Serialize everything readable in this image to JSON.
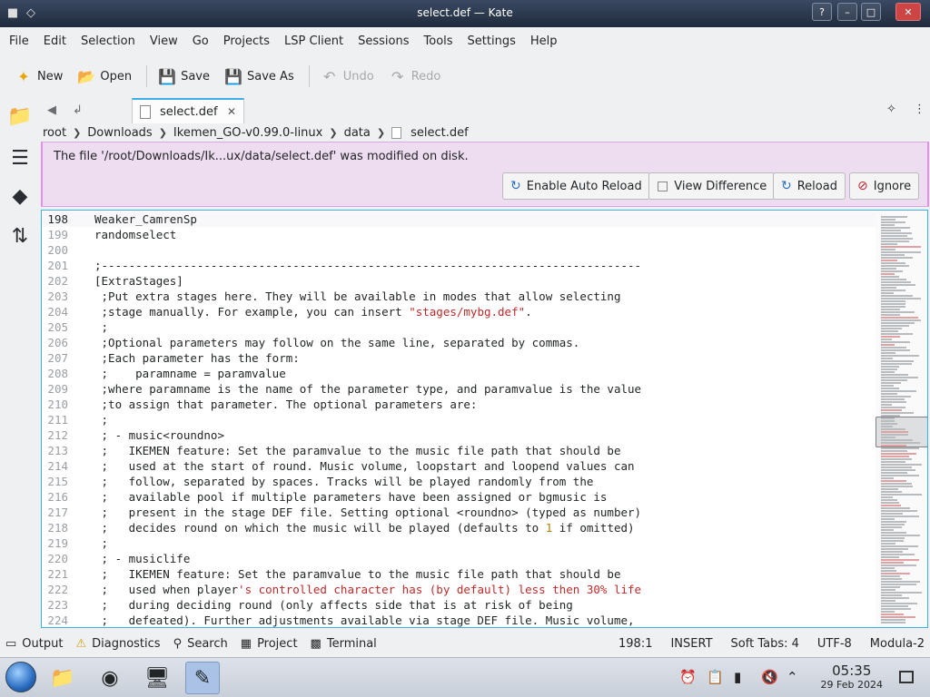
{
  "window": {
    "title": "select.def — Kate",
    "help_label": "?",
    "minimize_label": "–",
    "maximize_label": "□",
    "close_label": "✕"
  },
  "menu": [
    "File",
    "Edit",
    "Selection",
    "View",
    "Go",
    "Projects",
    "LSP Client",
    "Sessions",
    "Tools",
    "Settings",
    "Help"
  ],
  "toolbar": {
    "new": "New",
    "open": "Open",
    "save": "Save",
    "save_as": "Save As",
    "undo": "Undo",
    "redo": "Redo"
  },
  "tabs": {
    "active": "select.def",
    "close_label": "✕"
  },
  "breadcrumb": [
    "root",
    "Downloads",
    "Ikemen_GO-v0.99.0-linux",
    "data",
    "select.def"
  ],
  "banner": {
    "message": "The file '/root/Downloads/Ik...ux/data/select.def' was modified on disk.",
    "enable_auto_reload": "Enable Auto Reload",
    "view_difference": "View Difference",
    "reload": "Reload",
    "ignore": "Ignore"
  },
  "editor": {
    "lines": [
      {
        "n": "198",
        "text": "Weaker_CamrenSp",
        "current": true
      },
      {
        "n": "199",
        "text": "randomselect"
      },
      {
        "n": "200",
        "text": ""
      },
      {
        "n": "201",
        "text": ";-------------------------------------------------------------------------------"
      },
      {
        "n": "202",
        "text": "[ExtraStages]"
      },
      {
        "n": "203",
        "text": " ;Put extra stages here. They will be available in modes that allow selecting"
      },
      {
        "n": "204",
        "text": " ;stage manually. For example, you can insert ",
        "str": "\"stages/mybg.def\"",
        "after": "."
      },
      {
        "n": "205",
        "text": " ;"
      },
      {
        "n": "206",
        "text": " ;Optional parameters may follow on the same line, separated by commas."
      },
      {
        "n": "207",
        "text": " ;Each parameter has the form:"
      },
      {
        "n": "208",
        "text": " ;    paramname = paramvalue"
      },
      {
        "n": "209",
        "text": " ;where paramname is the name of the parameter type, and paramvalue is the value"
      },
      {
        "n": "210",
        "text": " ;to assign that parameter. The optional parameters are:"
      },
      {
        "n": "211",
        "text": " ;"
      },
      {
        "n": "212",
        "text": " ; - music<roundno>"
      },
      {
        "n": "213",
        "text": " ;   IKEMEN feature: Set the paramvalue to the music file path that should be"
      },
      {
        "n": "214",
        "text": " ;   used at the start of round. Music volume, loopstart and loopend values can"
      },
      {
        "n": "215",
        "text": " ;   follow, separated by spaces. Tracks will be played randomly from the"
      },
      {
        "n": "216",
        "text": " ;   available pool if multiple parameters have been assigned or bgmusic is"
      },
      {
        "n": "217",
        "text": " ;   present in the stage DEF file. Setting optional <roundno> (typed as number)"
      },
      {
        "n": "218",
        "text": " ;   decides round on which the music will be played (defaults to ",
        "num": "1",
        "after": " if omitted)"
      },
      {
        "n": "219",
        "text": " ;"
      },
      {
        "n": "220",
        "text": " ; - musiclife"
      },
      {
        "n": "221",
        "text": " ;   IKEMEN feature: Set the paramvalue to the music file path that should be"
      },
      {
        "n": "222",
        "text": " ;   used when player",
        "str": "'s controlled character has (by default) less then 30% life",
        "after": ""
      },
      {
        "n": "223",
        "text": " ;   during deciding round (only affects side that is at risk of being"
      },
      {
        "n": "224",
        "text": " ;   defeated). Further adjustments available via stage DEF file. Music volume,"
      }
    ]
  },
  "panels": {
    "output": "Output",
    "diagnostics": "Diagnostics",
    "search": "Search",
    "project": "Project",
    "terminal": "Terminal"
  },
  "status": {
    "position": "198:1",
    "mode": "INSERT",
    "tabs": "Soft Tabs: 4",
    "encoding": "UTF-8",
    "syntax": "Modula-2"
  },
  "taskbar": {
    "time": "05:35",
    "date": "29 Feb 2024"
  }
}
